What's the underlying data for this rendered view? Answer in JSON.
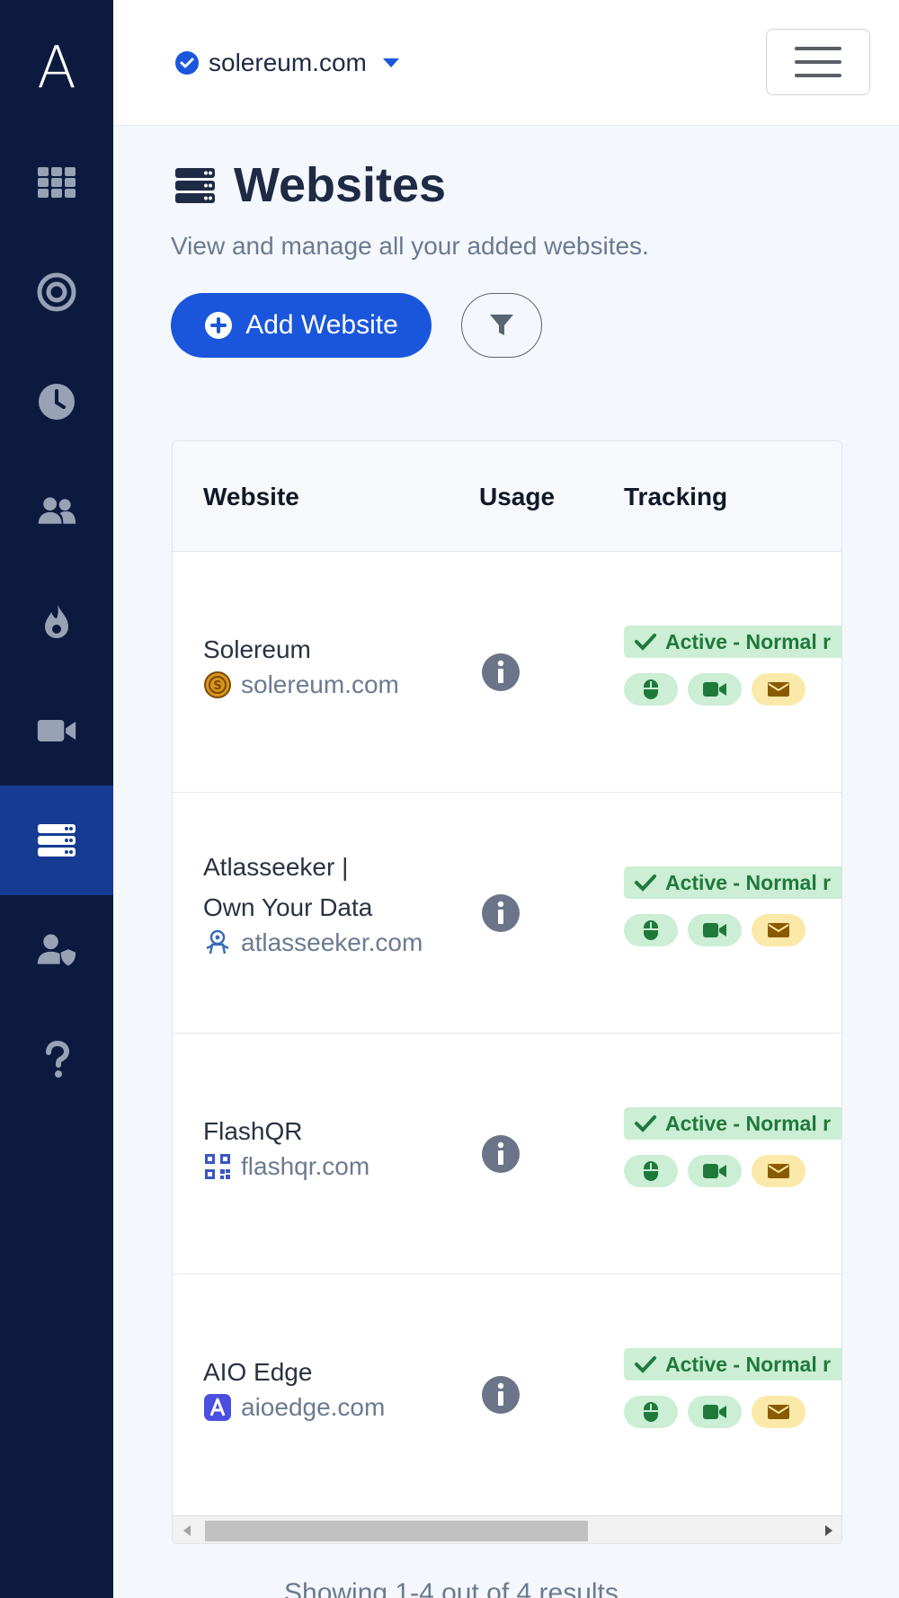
{
  "app": {
    "logo_letter": "A"
  },
  "colors": {
    "sidebar_bg": "#0b1a3e",
    "sidebar_active": "#153b93",
    "accent": "#1a56db",
    "success_bg": "#cbeed5",
    "success_text": "#1f7a3a",
    "warning_bg": "#fbe9a9"
  },
  "sidebar": {
    "items": [
      {
        "icon": "grid-icon",
        "active": false
      },
      {
        "icon": "target-icon",
        "active": false
      },
      {
        "icon": "clock-icon",
        "active": false
      },
      {
        "icon": "users-icon",
        "active": false
      },
      {
        "icon": "fire-icon",
        "active": false
      },
      {
        "icon": "video-icon",
        "active": false
      },
      {
        "icon": "server-icon",
        "active": true
      },
      {
        "icon": "user-shield-icon",
        "active": false
      },
      {
        "icon": "question-icon",
        "active": false
      }
    ]
  },
  "header": {
    "selected_site": "solereum.com"
  },
  "page": {
    "title": "Websites",
    "subtitle": "View and manage all your added websites.",
    "add_button": "Add Website"
  },
  "table": {
    "columns": [
      "Website",
      "Usage",
      "Tracking"
    ],
    "rows": [
      {
        "name": "Solereum",
        "domain": "solereum.com",
        "favicon": "coin-icon",
        "status": "Active - Normal r"
      },
      {
        "name_line1": "Atlasseeker |",
        "name_line2": "Own Your Data",
        "domain": "atlasseeker.com",
        "favicon": "astronaut-icon",
        "status": "Active - Normal r"
      },
      {
        "name": "FlashQR",
        "domain": "flashqr.com",
        "favicon": "qr-code-icon",
        "status": "Active - Normal r"
      },
      {
        "name": "AIO Edge",
        "domain": "aioedge.com",
        "favicon": "aio-logo-icon",
        "status": "Active - Normal r"
      }
    ]
  },
  "footer": {
    "results": "Showing 1-4 out of 4 results"
  }
}
